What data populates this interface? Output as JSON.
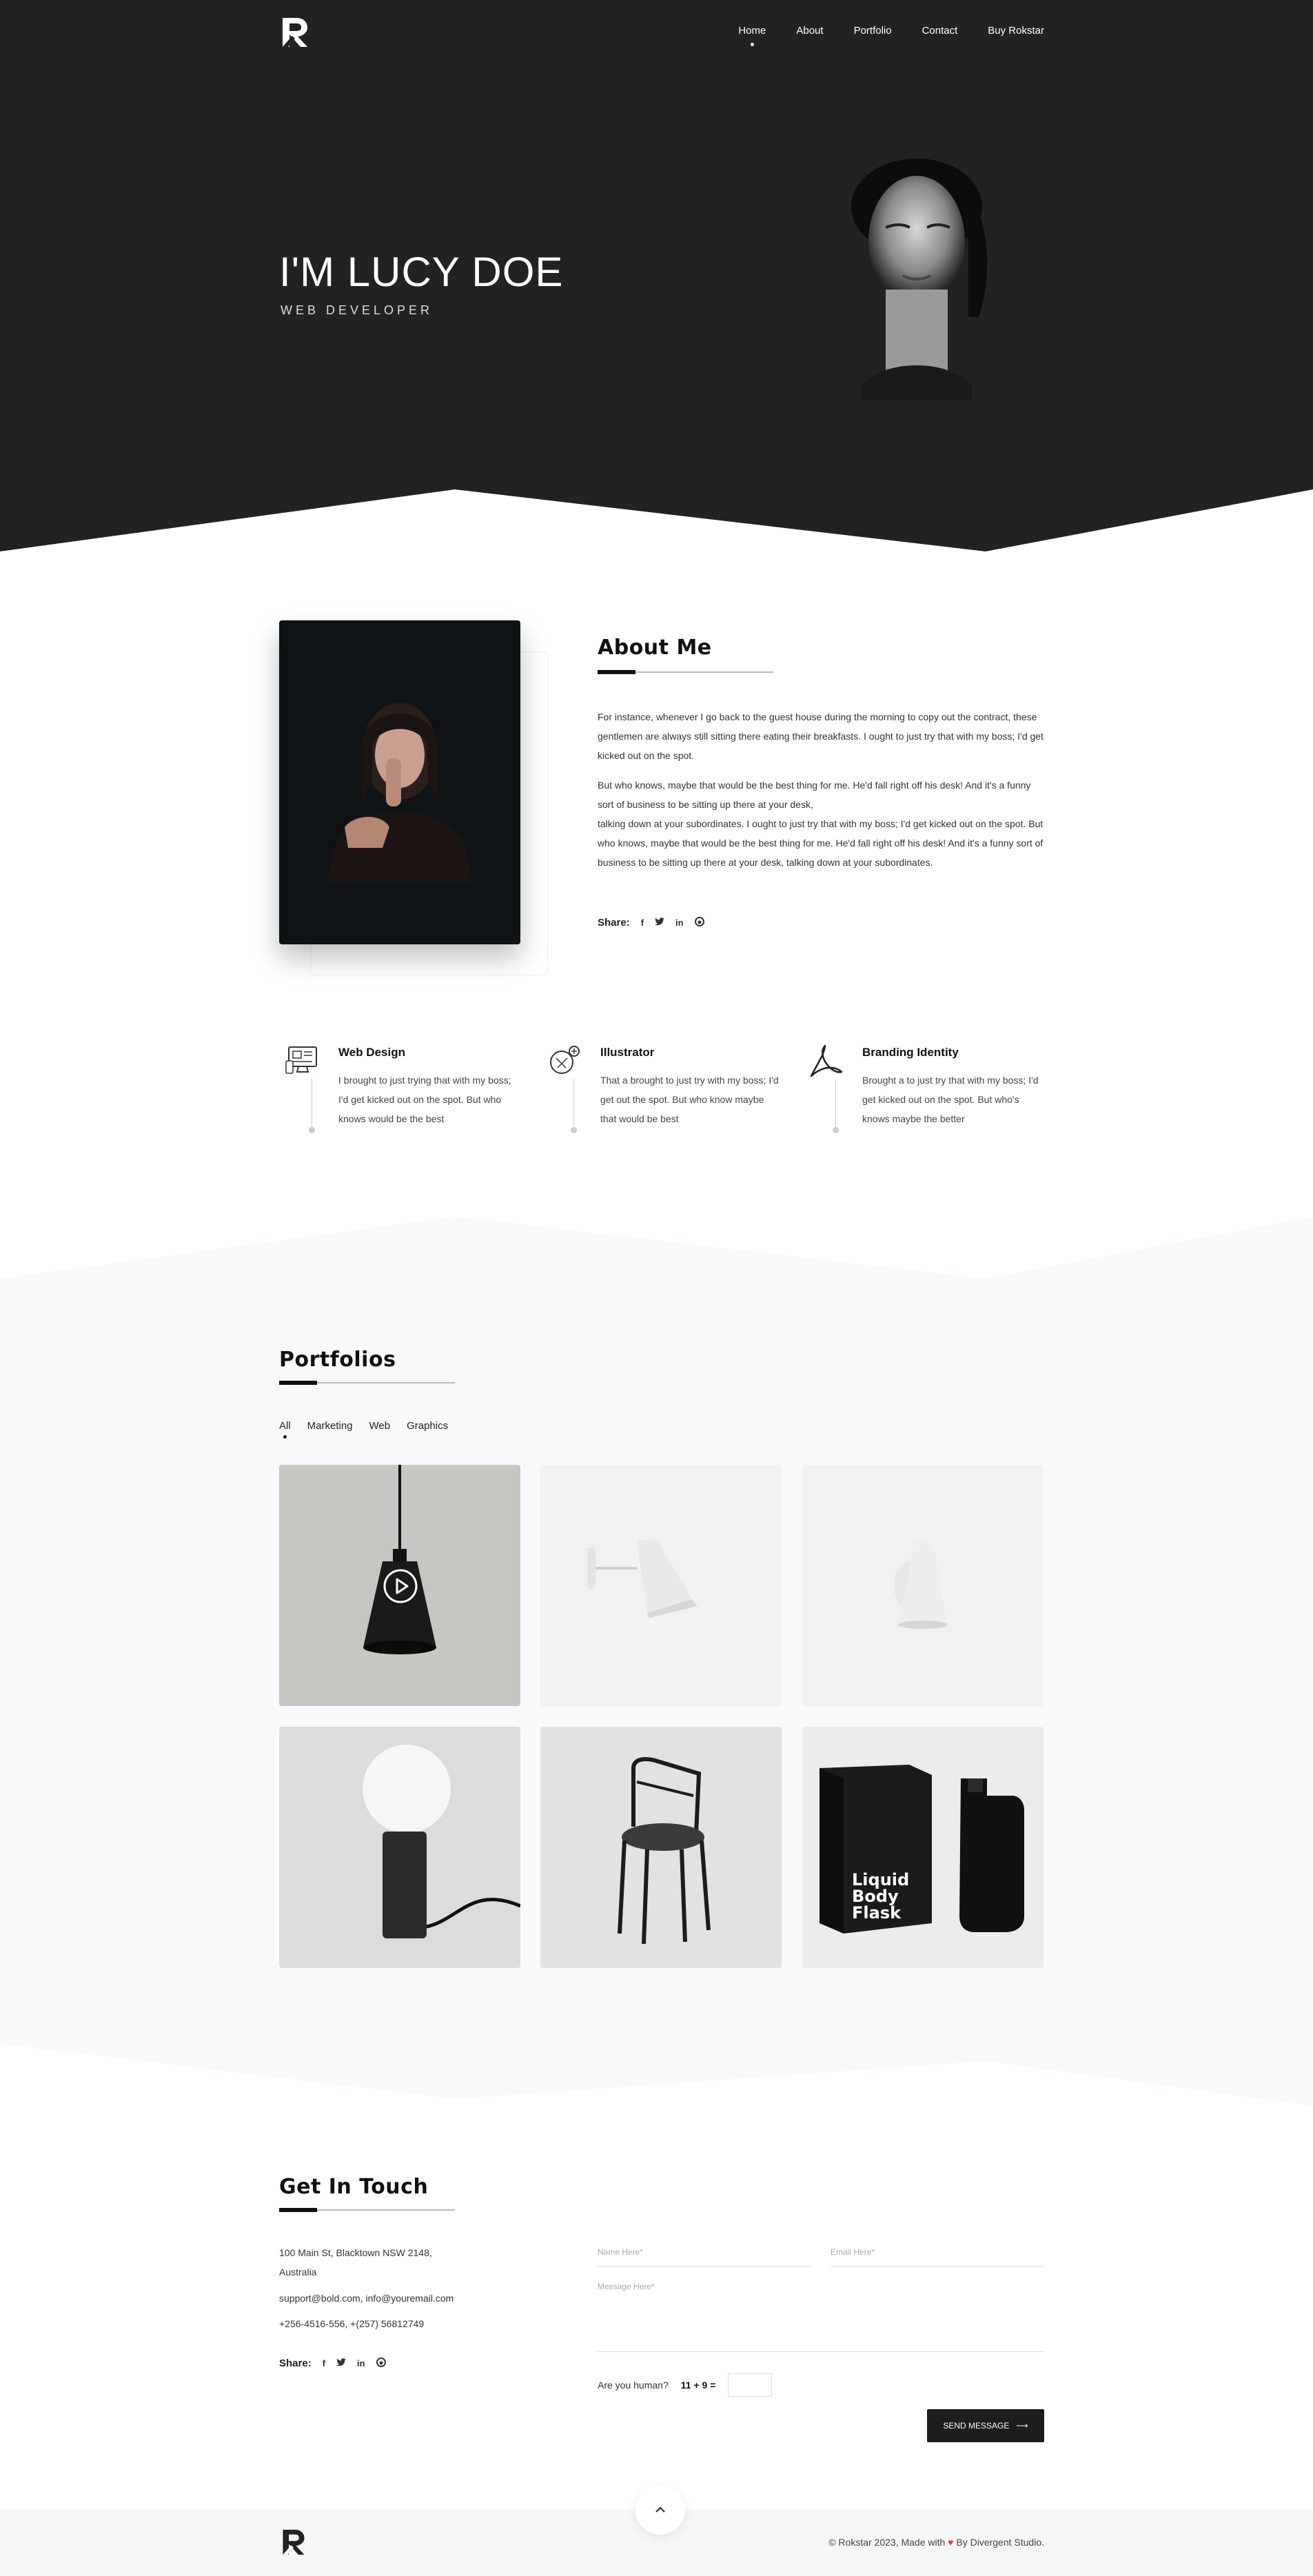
{
  "nav": {
    "items": [
      {
        "label": "Home"
      },
      {
        "label": "About"
      },
      {
        "label": "Portfolio"
      },
      {
        "label": "Contact"
      },
      {
        "label": "Buy Rokstar"
      }
    ],
    "logo_icon": "rokstar-logo-icon"
  },
  "hero": {
    "title": "I'M LUCY DOE",
    "subtitle": "WEB DEVELOPER"
  },
  "about": {
    "title": "About Me",
    "paragraph1": "For instance, whenever I go back to the guest house during the morning to copy out the contract, these gentlemen are always still sitting there eating their breakfasts. I ought to just try that with my boss; I'd get kicked out on the spot.",
    "paragraph2a": "But who knows, maybe that would be the best thing for me. He'd fall right off his desk! And it's a funny sort of business to be sitting up there at your desk,",
    "paragraph2b": "talking down at your subordinates. I ought to just try that with my boss; I'd get kicked out on the spot. But who knows, maybe that would be the best thing for me. He'd fall right off his desk! And it's a funny sort of business to be sitting up there at your desk, talking down at your subordinates.",
    "share_label": "Share:"
  },
  "share_icons": [
    "facebook-icon",
    "twitter-icon",
    "linkedin-icon",
    "github-icon"
  ],
  "services": [
    {
      "title": "Web Design",
      "text": "I brought to just trying that with my boss; I'd get kicked out on the spot. But who knows would be the best",
      "icon": "web-design-icon"
    },
    {
      "title": "Illustrator",
      "text": "That a brought to just try with my boss; I'd get out the spot. But who know maybe that would be best",
      "icon": "illustrator-icon"
    },
    {
      "title": "Branding Identity",
      "text": "Brought a to just try that with my boss; I'd get kicked out on the spot. But who's knows maybe the better",
      "icon": "branding-icon"
    }
  ],
  "portfolio": {
    "title": "Portfolios",
    "filters": [
      {
        "label": "All"
      },
      {
        "label": "Marketing"
      },
      {
        "label": "Web"
      },
      {
        "label": "Graphics"
      }
    ],
    "tile_flask_text": [
      "Liquid",
      "Body",
      "Flask"
    ]
  },
  "contact": {
    "title": "Get In Touch",
    "address_line1": "100 Main St, Blacktown NSW 2148,",
    "address_line2": "Australia",
    "emails": "support@bold.com, info@youremail.com",
    "phones": "+256-4516-556, +(257) 56812749",
    "share_label": "Share:",
    "name_placeholder": "Name Here*",
    "email_placeholder": "Email Here*",
    "message_placeholder": "Message Here*",
    "captcha_label": "Are you human?",
    "captcha_question": "11 + 9 =",
    "send_label": "SEND MESSAGE"
  },
  "footer": {
    "copy_prefix": "© Rokstar 2023, Made with",
    "copy_suffix": "By Divergent Studio.",
    "heart": "♥"
  },
  "colors": {
    "hero_bg": "#222222",
    "portfolio_bg": "#f8f9fb",
    "heart": "#e23a3a"
  }
}
